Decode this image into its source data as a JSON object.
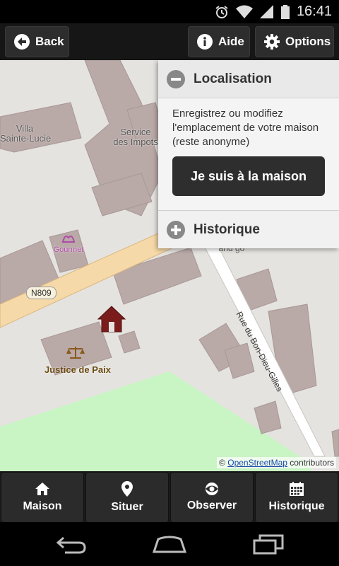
{
  "status_bar": {
    "time": "16:41",
    "icons": [
      "alarm-icon",
      "wifi-icon",
      "signal-icon",
      "battery-icon"
    ]
  },
  "action_bar": {
    "back_label": "Back",
    "help_label": "Aide",
    "options_label": "Options"
  },
  "map": {
    "labels": {
      "villa": "Villa\nSainte-Lucie",
      "service": "Service\ndes Impots",
      "gourmet": "Gourmet",
      "justice": "Justice de Paix",
      "partial": "and go",
      "street": "Rue du Bon-Dieu-Gilles",
      "road_ref": "N809"
    },
    "attribution": {
      "prefix": "© ",
      "link": "OpenStreetMap",
      "suffix": " contributors"
    },
    "colors": {
      "background": "#e5e3df",
      "building": "#b9a9a7",
      "main_road": "#f6d9a8",
      "park": "#c9f4c4",
      "house_marker": "#7a1c1c"
    }
  },
  "panel": {
    "localisation_title": "Localisation",
    "description": "Enregistrez ou modifiez l'emplacement de votre maison (reste anonyme)",
    "home_button": "Je suis à la maison",
    "history_title": "Historique"
  },
  "tabs": [
    {
      "label": "Maison",
      "icon": "home-icon"
    },
    {
      "label": "Situer",
      "icon": "location-pin-icon"
    },
    {
      "label": "Observer",
      "icon": "eye-icon"
    },
    {
      "label": "Historique",
      "icon": "calendar-icon"
    }
  ],
  "nav_bar": {
    "buttons": [
      "back-nav-icon",
      "home-nav-icon",
      "recents-nav-icon"
    ]
  }
}
